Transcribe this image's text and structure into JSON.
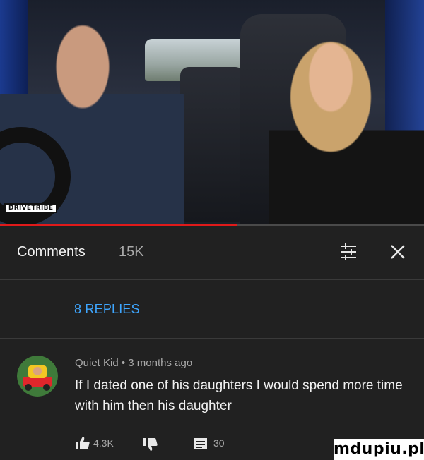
{
  "video": {
    "channel_badge": "DRIVETRIBE",
    "progress_fraction": 0.56
  },
  "comments_header": {
    "title": "Comments",
    "count": "15K",
    "sort_icon": "sort-icon",
    "close_icon": "close-icon"
  },
  "replies_toggle": {
    "label": "8 REPLIES"
  },
  "comment": {
    "author": "Quiet Kid",
    "separator": "•",
    "age": "3 months ago",
    "meta": "Quiet Kid • 3 months ago",
    "text": "If I dated one of his daughters I would spend more time with him then his daughter",
    "likes": "4.3K",
    "replies_count": "30",
    "avatar_icon": "toy-car-avatar",
    "like_icon": "thumbs-up-icon",
    "dislike_icon": "thumbs-down-icon",
    "reply_icon": "reply-icon"
  },
  "watermark": "mdupiu.pl",
  "colors": {
    "background": "#212121",
    "accent_blue": "#3ea6ff",
    "progress_red": "#e01a1a",
    "secondary_text": "#aaaaaa"
  }
}
